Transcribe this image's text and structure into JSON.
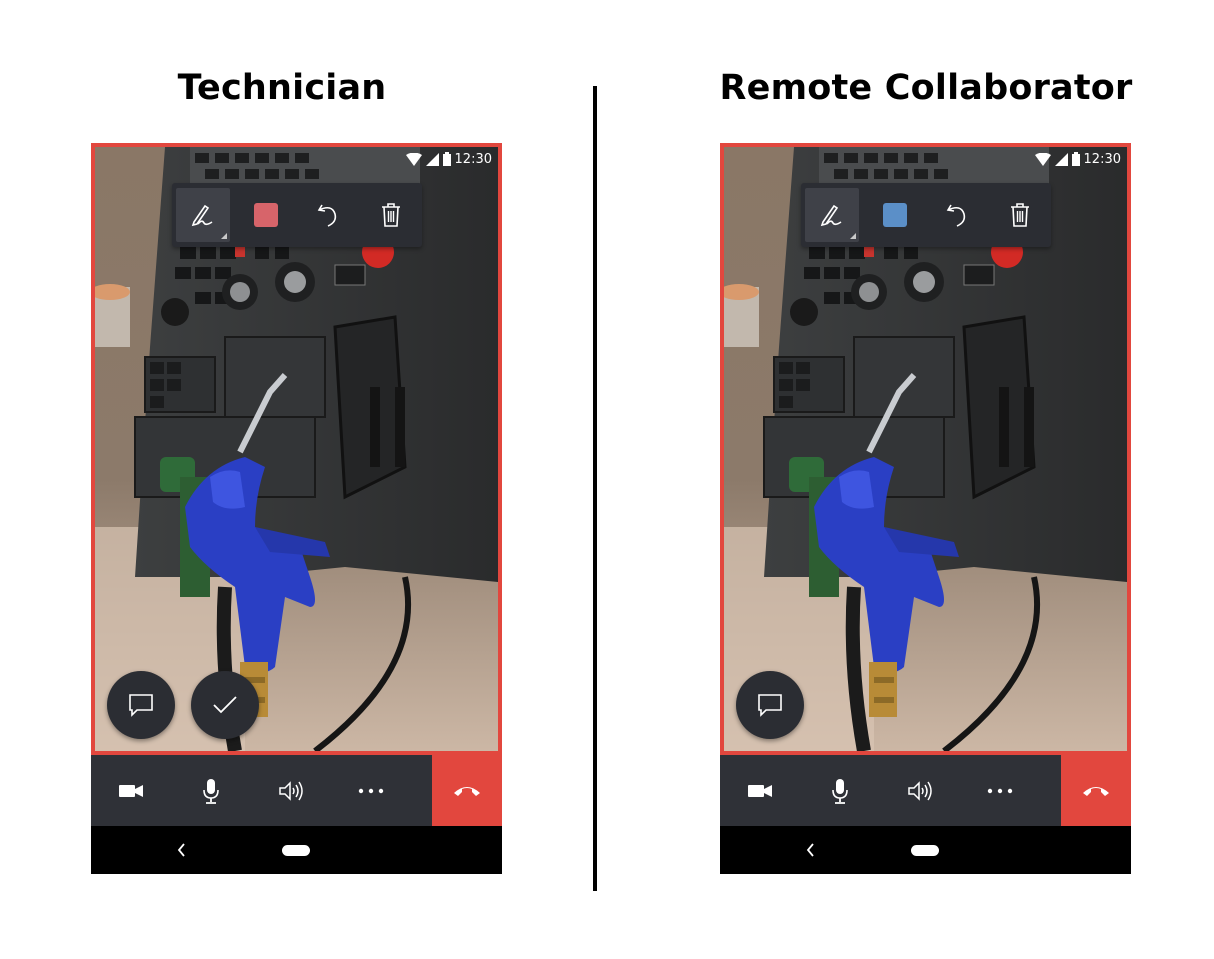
{
  "left_panel": {
    "heading": "Technician",
    "status_time": "12:30",
    "pen_color": "#d7646a",
    "fabs": [
      "chat-icon",
      "check-icon"
    ]
  },
  "right_panel": {
    "heading": "Remote Collaborator",
    "status_time": "12:30",
    "pen_color": "#5b8fc8",
    "fabs": [
      "chat-icon"
    ]
  },
  "toolbar_icons": [
    "pen-icon",
    "color-swatch",
    "undo-icon",
    "trash-icon"
  ],
  "call_controls": [
    "video-camera-icon",
    "microphone-icon",
    "speaker-icon",
    "more-icon",
    "end-call-icon"
  ],
  "colors": {
    "accent_red": "#e2473e",
    "bar_dark": "#2f3137",
    "toolbar_dark": "#2b2d33"
  }
}
